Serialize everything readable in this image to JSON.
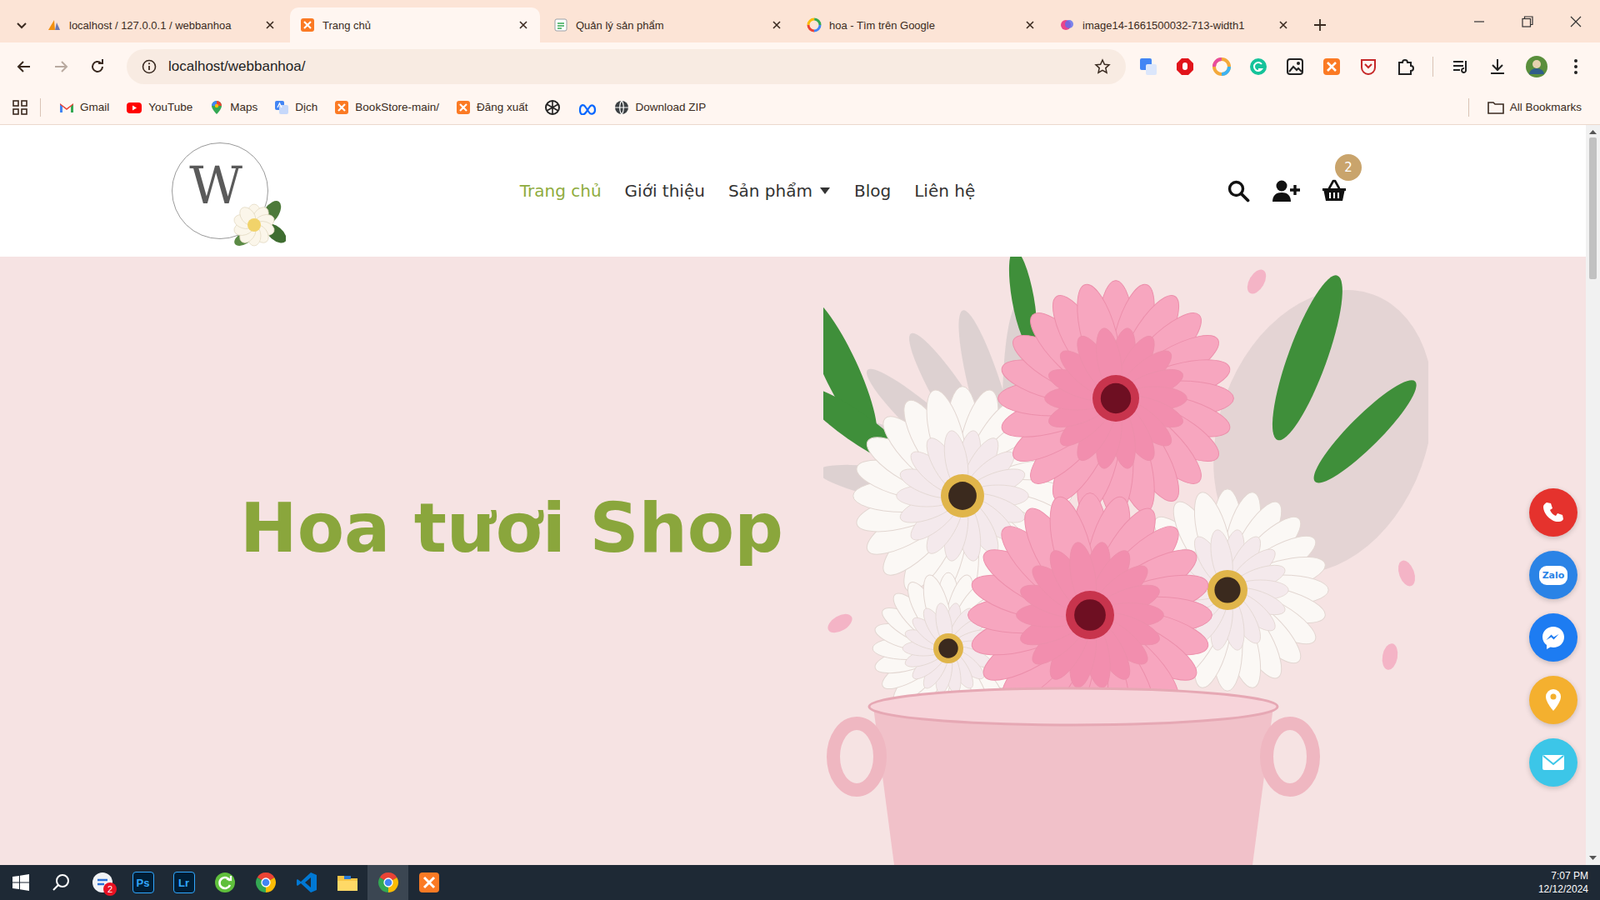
{
  "browser": {
    "tabs": [
      {
        "label": "localhost / 127.0.0.1 / webbanhoa",
        "kind": "phpmyadmin",
        "selected": false
      },
      {
        "label": "Trang chủ",
        "kind": "xampp",
        "selected": true
      },
      {
        "label": "Quản lý sản phẩm",
        "kind": "document",
        "selected": false
      },
      {
        "label": "hoa - Tìm trên Google",
        "kind": "google",
        "selected": false
      },
      {
        "label": "image14-1661500032-713-width1",
        "kind": "image",
        "selected": false
      }
    ],
    "address": "localhost/webbanhoa/",
    "bookmarks": [
      {
        "label": "Gmail",
        "kind": "gmail"
      },
      {
        "label": "YouTube",
        "kind": "youtube"
      },
      {
        "label": "Maps",
        "kind": "maps"
      },
      {
        "label": "Dịch",
        "kind": "translate"
      },
      {
        "label": "BookStore-main/",
        "kind": "xampp"
      },
      {
        "label": "Đăng xuất",
        "kind": "xampp"
      },
      {
        "label": "",
        "kind": "openai"
      },
      {
        "label": "",
        "kind": "meta"
      },
      {
        "label": "Download ZIP",
        "kind": "globe"
      }
    ],
    "all_bookmarks": "All Bookmarks"
  },
  "site": {
    "logo": "W",
    "nav": [
      {
        "label": "Trang chủ",
        "selected": true,
        "dropdown": false
      },
      {
        "label": "Giới thiệu",
        "selected": false,
        "dropdown": false
      },
      {
        "label": "Sản phẩm",
        "selected": false,
        "dropdown": true
      },
      {
        "label": "Blog",
        "selected": false,
        "dropdown": false
      },
      {
        "label": "Liên hệ",
        "selected": false,
        "dropdown": false
      }
    ],
    "cart_count": "2",
    "hero_title": "Hoa tươi Shop",
    "contacts": [
      {
        "kind": "phone",
        "label": "",
        "color": "#e5322d"
      },
      {
        "kind": "zalo",
        "label": "Zalo",
        "color": "#2a83e6"
      },
      {
        "kind": "messenger",
        "label": "",
        "color": "#1d7cf2"
      },
      {
        "kind": "location",
        "label": "",
        "color": "#f4b02f"
      },
      {
        "kind": "email",
        "label": "",
        "color": "#3cc6e8"
      }
    ]
  },
  "taskbar": {
    "apps": [
      {
        "kind": "start",
        "label": "",
        "badge": "",
        "selected": false
      },
      {
        "kind": "search",
        "label": "",
        "badge": "",
        "selected": false
      },
      {
        "kind": "chat",
        "label": "",
        "badge": "2",
        "selected": false
      },
      {
        "kind": "photoshop",
        "label": "Ps",
        "badge": "",
        "selected": false
      },
      {
        "kind": "lightroom",
        "label": "Lr",
        "badge": "",
        "selected": false
      },
      {
        "kind": "sync",
        "label": "",
        "badge": "",
        "selected": false
      },
      {
        "kind": "chrome",
        "label": "",
        "badge": "",
        "selected": false
      },
      {
        "kind": "vscode",
        "label": "",
        "badge": "",
        "selected": false
      },
      {
        "kind": "explorer",
        "label": "",
        "badge": "",
        "selected": false
      },
      {
        "kind": "chrome",
        "label": "",
        "badge": "",
        "selected": true
      },
      {
        "kind": "xampp",
        "label": "",
        "badge": "",
        "selected": false
      }
    ],
    "time": "7:07 PM",
    "date": "12/12/2024"
  }
}
